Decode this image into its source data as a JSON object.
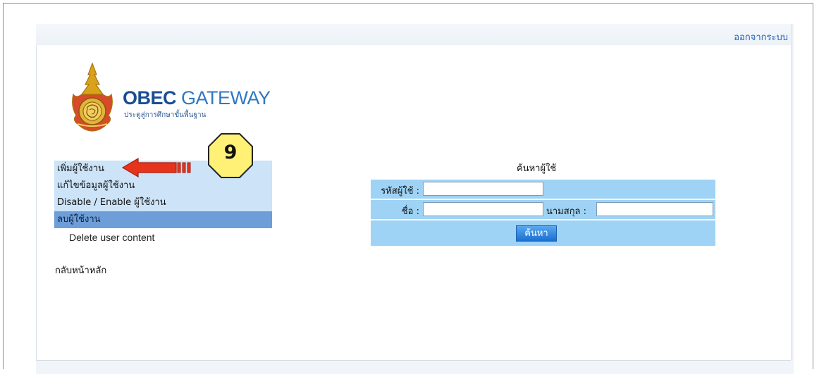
{
  "header": {
    "logout_label": "ออกจากระบบ"
  },
  "logo": {
    "title_bold": "OBEC",
    "title_regular": "GATEWAY",
    "subtitle": "ประตูสู่การศึกษาขั้นพื้นฐาน"
  },
  "menu": {
    "items": [
      {
        "label": "เพิ่มผู้ใช้งาน"
      },
      {
        "label": "แก้ไขข้อมูลผู้ใช้งาน"
      },
      {
        "label": "Disable / Enable ผู้ใช้งาน"
      },
      {
        "label": "ลบผู้ใช้งาน"
      }
    ],
    "sub_item": "Delete user content",
    "home_link": "กลับหน้าหลัก"
  },
  "callout": {
    "step_number": "9",
    "arrow_color": "#e8331c",
    "badge_color": "#fff176"
  },
  "search": {
    "title": "ค้นหาผู้ใช้",
    "user_id_label": "รหัสผู้ใช้ :",
    "user_id_value": "",
    "first_name_label": "ชื่อ :",
    "first_name_value": "",
    "last_name_label": "นามสกุล :",
    "last_name_value": "",
    "button_label": "ค้นหา"
  },
  "colors": {
    "menu_bg": "#cce3f8",
    "menu_active_bg": "#6d9ed8",
    "search_box_bg": "#9fd3f5",
    "button_bg": "#1a6fd2",
    "link_color": "#1f63b8"
  }
}
